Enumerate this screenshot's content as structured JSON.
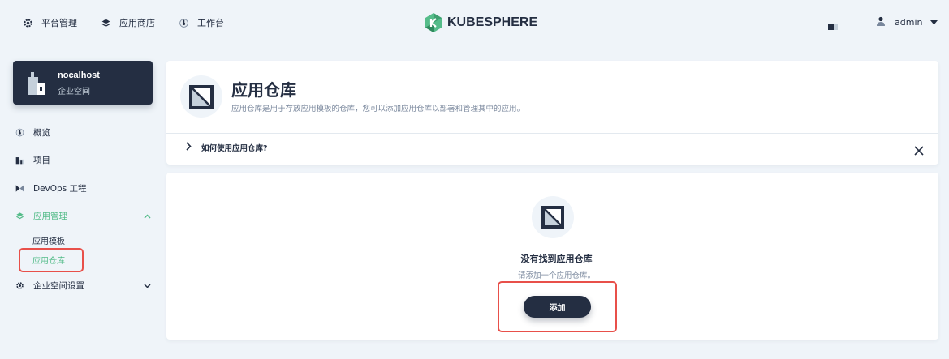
{
  "topnav": {
    "items": [
      {
        "label": "平台管理",
        "icon": "gear-icon"
      },
      {
        "label": "应用商店",
        "icon": "appstore-icon"
      },
      {
        "label": "工作台",
        "icon": "dashboard-icon"
      }
    ],
    "logo_text": "KUBESPHERE",
    "user": "admin"
  },
  "sidebar": {
    "workspace": {
      "name": "nocalhost",
      "type": "企业空间"
    },
    "items": [
      {
        "label": "概览",
        "icon": "dashboard-icon"
      },
      {
        "label": "项目",
        "icon": "project-icon"
      },
      {
        "label": "DevOps 工程",
        "icon": "devops-icon"
      },
      {
        "label": "应用管理",
        "icon": "appstore-icon",
        "active": true,
        "expanded": true
      },
      {
        "label": "企业空间设置",
        "icon": "gear-icon",
        "expanded": false
      }
    ],
    "sub_items": [
      {
        "label": "应用模板"
      },
      {
        "label": "应用仓库",
        "active": true
      }
    ]
  },
  "header": {
    "title": "应用仓库",
    "description": "应用仓库是用于存放应用模板的仓库，您可以添加应用仓库以部署和管理其中的应用。",
    "howto": "如何使用应用仓库?"
  },
  "empty": {
    "title": "没有找到应用仓库",
    "description": "请添加一个应用仓库。",
    "add_label": "添加"
  },
  "colors": {
    "accent": "#55bc8a",
    "dark": "#242e42",
    "highlight": "#e8504a"
  }
}
